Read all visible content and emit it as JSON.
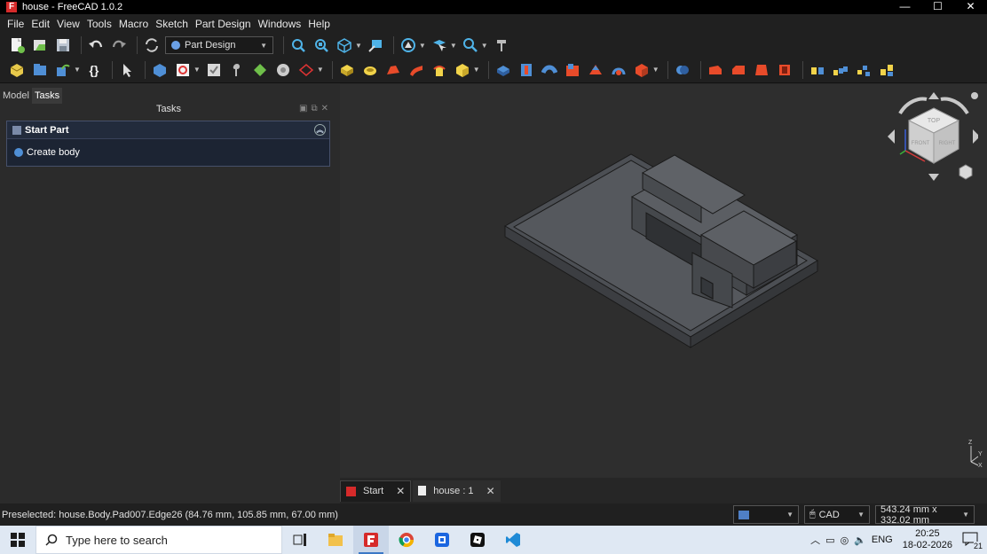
{
  "window": {
    "title": "house - FreeCAD 1.0.2",
    "minimize": "—",
    "maximize": "☐",
    "close": "✕"
  },
  "menu": [
    "File",
    "Edit",
    "View",
    "Tools",
    "Macro",
    "Sketch",
    "Part Design",
    "Windows",
    "Help"
  ],
  "toolbar": {
    "workbench": "Part Design"
  },
  "panel": {
    "tabs": [
      "Model",
      "Tasks"
    ],
    "active_tab": "Tasks",
    "header": "Tasks",
    "task_title": "Start Part",
    "task_item": "Create body"
  },
  "nav_cube": {
    "top": "TOP",
    "front": "FRONT",
    "right": "RIGHT"
  },
  "axis": {
    "z": "Z",
    "y": "Y",
    "x": "X"
  },
  "doc_tabs": [
    {
      "label": "Start",
      "active": false
    },
    {
      "label": "house : 1",
      "active": true
    }
  ],
  "status": {
    "message": "Preselected: house.Body.Pad007.Edge26 (84.76 mm, 105.85 mm, 67.00 mm)",
    "nav_style": "CAD",
    "dimensions": "543.24 mm x 332.02 mm"
  },
  "taskbar": {
    "search_placeholder": "Type here to search",
    "language": "ENG",
    "time": "20:25",
    "date": "18-02-2026",
    "notifications": "21"
  },
  "colors": {
    "background": "#2e2e2e",
    "model_face": "#4a4d52",
    "accent": "#3b78c6"
  }
}
